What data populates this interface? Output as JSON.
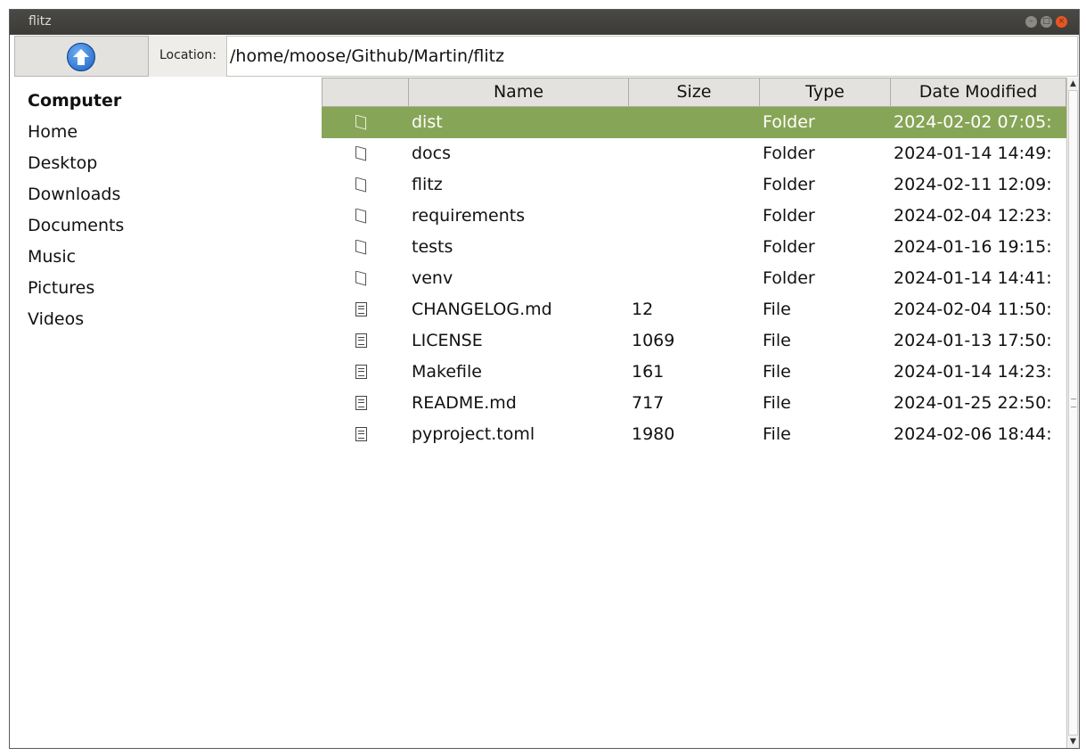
{
  "window": {
    "title": "flitz"
  },
  "toolbar": {
    "location_label": "Location:",
    "location_value": "/home/moose/Github/Martin/flitz"
  },
  "sidebar": {
    "items": [
      {
        "label": "Computer"
      },
      {
        "label": "Home"
      },
      {
        "label": "Desktop"
      },
      {
        "label": "Downloads"
      },
      {
        "label": "Documents"
      },
      {
        "label": "Music"
      },
      {
        "label": "Pictures"
      },
      {
        "label": "Videos"
      }
    ]
  },
  "table": {
    "columns": [
      "",
      "Name",
      "Size",
      "Type",
      "Date Modified"
    ],
    "rows": [
      {
        "icon": "folder-icon",
        "name": "dist",
        "size": "",
        "type": "Folder",
        "date": "2024-02-02 07:05:",
        "selected": true
      },
      {
        "icon": "folder-icon",
        "name": "docs",
        "size": "",
        "type": "Folder",
        "date": "2024-01-14 14:49:"
      },
      {
        "icon": "folder-icon",
        "name": "flitz",
        "size": "",
        "type": "Folder",
        "date": "2024-02-11 12:09:"
      },
      {
        "icon": "folder-icon",
        "name": "requirements",
        "size": "",
        "type": "Folder",
        "date": "2024-02-04 12:23:"
      },
      {
        "icon": "folder-icon",
        "name": "tests",
        "size": "",
        "type": "Folder",
        "date": "2024-01-16 19:15:"
      },
      {
        "icon": "folder-icon",
        "name": "venv",
        "size": "",
        "type": "Folder",
        "date": "2024-01-14 14:41:"
      },
      {
        "icon": "file-icon",
        "name": "CHANGELOG.md",
        "size": "12",
        "type": "File",
        "date": "2024-02-04 11:50:"
      },
      {
        "icon": "file-icon",
        "name": "LICENSE",
        "size": "1069",
        "type": "File",
        "date": "2024-01-13 17:50:"
      },
      {
        "icon": "file-icon",
        "name": "Makefile",
        "size": "161",
        "type": "File",
        "date": "2024-01-14 14:23:"
      },
      {
        "icon": "file-icon",
        "name": "README.md",
        "size": "717",
        "type": "File",
        "date": "2024-01-25 22:50:"
      },
      {
        "icon": "file-icon",
        "name": "pyproject.toml",
        "size": "1980",
        "type": "File",
        "date": "2024-02-06 18:44:"
      }
    ]
  },
  "colors": {
    "selection": "#87a556",
    "titlebar": "#3c3b37",
    "header_bg": "#e4e2df"
  }
}
